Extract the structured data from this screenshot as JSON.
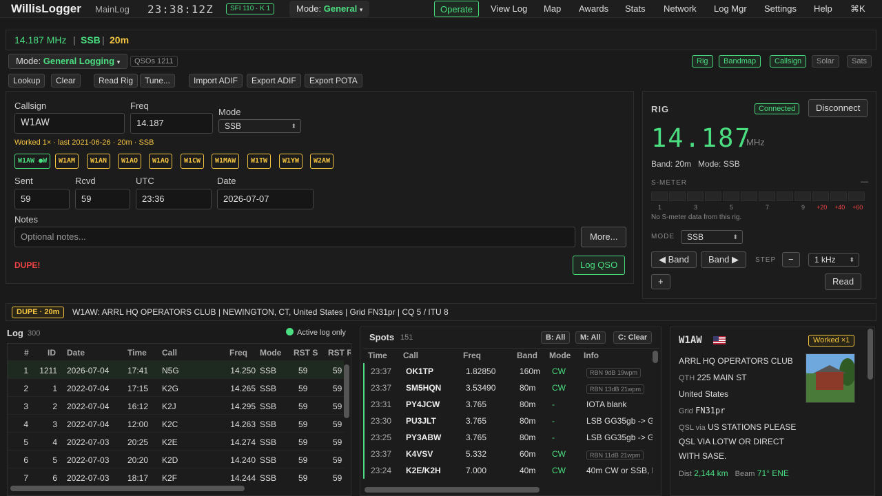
{
  "topbar": {
    "app_title": "WillisLogger",
    "log_name": "MainLog",
    "clock": "23:38:12Z",
    "sfi_badge": "SFI 110 · K 1",
    "mode_label": "Mode:",
    "mode_value": "General",
    "nav": [
      "Operate",
      "View Log",
      "Map",
      "Awards",
      "Stats",
      "Network",
      "Log Mgr",
      "Settings",
      "Help",
      "⌘K"
    ]
  },
  "freqline": {
    "freq": "14.187 MHz",
    "mode": "SSB",
    "band": "20m",
    "sep": "|"
  },
  "mode_row": {
    "label": "Mode:",
    "value": "General Logging",
    "qso_count": "QSOs 1211",
    "toggles": [
      "Rig",
      "Bandmap",
      "Callsign",
      "Solar",
      "Sats"
    ]
  },
  "toolbar": [
    "Lookup",
    "Clear",
    "Read Rig",
    "Tune...",
    "Import ADIF",
    "Export ADIF",
    "Export POTA"
  ],
  "entry": {
    "callsign_label": "Callsign",
    "callsign": "W1AW",
    "freq_label": "Freq",
    "freq": "14.187",
    "mode_label": "Mode",
    "mode": "SSB",
    "worked_info": "Worked 1× · last 2021-06-26 · 20m · SSB",
    "chips": [
      "W1AW ●W",
      "W1AM",
      "W1AN",
      "W1AO",
      "W1AQ",
      "W1CW",
      "W1MAW",
      "W1TW",
      "W1YW",
      "W2AW"
    ],
    "sent_label": "Sent",
    "sent": "59",
    "rcvd_label": "Rcvd",
    "rcvd": "59",
    "utc_label": "UTC",
    "utc": "23:36",
    "date_label": "Date",
    "date": "2026-07-07",
    "notes_label": "Notes",
    "notes_placeholder": "Optional notes...",
    "more_button": "More...",
    "dupe_label": "DUPE!",
    "log_button": "Log QSO"
  },
  "rig": {
    "title": "RIG",
    "status": "Connected",
    "disconnect": "Disconnect",
    "freq": "14.187",
    "unit": "MHz",
    "band_mode": "Band: 20m   Mode: SSB",
    "smeter_title": "S-METER",
    "smeter_dash": "—",
    "ticks": [
      "1",
      "3",
      "5",
      "7",
      "9",
      "+20",
      "+40",
      "+60"
    ],
    "smeter_note": "No S-meter data from this rig.",
    "mode_label": "MODE",
    "mode": "SSB",
    "band_down": "◀ Band",
    "band_up": "Band ▶",
    "step_label": "STEP",
    "minus": "−",
    "step": "1 kHz",
    "plus": "+",
    "read": "Read"
  },
  "dupeline": {
    "badge": "DUPE · 20m",
    "text": "W1AW: ARRL HQ OPERATORS CLUB | NEWINGTON, CT, United States | Grid FN31pr | CQ 5 / ITU 8"
  },
  "log": {
    "title": "Log",
    "count": "300",
    "active_only": "Active log only",
    "columns": [
      "#",
      "ID",
      "Date",
      "Time",
      "Call",
      "Freq",
      "Mode",
      "RST S",
      "RST R"
    ],
    "rows": [
      [
        "1",
        "1211",
        "2026-07-04",
        "17:41",
        "N5G",
        "14.250",
        "SSB",
        "59",
        "59"
      ],
      [
        "2",
        "1",
        "2022-07-04",
        "17:15",
        "K2G",
        "14.265",
        "SSB",
        "59",
        "59"
      ],
      [
        "3",
        "2",
        "2022-07-04",
        "16:12",
        "K2J",
        "14.295",
        "SSB",
        "59",
        "59"
      ],
      [
        "4",
        "3",
        "2022-07-04",
        "12:00",
        "K2C",
        "14.263",
        "SSB",
        "59",
        "59"
      ],
      [
        "5",
        "4",
        "2022-07-03",
        "20:25",
        "K2E",
        "14.274",
        "SSB",
        "59",
        "59"
      ],
      [
        "6",
        "5",
        "2022-07-03",
        "20:20",
        "K2D",
        "14.240",
        "SSB",
        "59",
        "59"
      ],
      [
        "7",
        "6",
        "2022-07-03",
        "18:17",
        "K2F",
        "14.244",
        "SSB",
        "59",
        "59"
      ]
    ]
  },
  "spots": {
    "title": "Spots",
    "count": "151",
    "filters": [
      "B: All",
      "M: All",
      "C: Clear"
    ],
    "columns": [
      "Time",
      "Call",
      "Freq",
      "Band",
      "Mode",
      "Info"
    ],
    "rows": [
      [
        "23:37",
        "OK1TP",
        "1.82850",
        "160m",
        "CW",
        "RBN 9dB 19wpm"
      ],
      [
        "23:37",
        "SM5HQN",
        "3.53490",
        "80m",
        "CW",
        "RBN 13dB 21wpm"
      ],
      [
        "23:31",
        "PY4JCW",
        "3.765",
        "80m",
        "-",
        "IOTA blank"
      ],
      [
        "23:30",
        "PU3JLT",
        "3.765",
        "80m",
        "-",
        "LSB GG35gb -> G"
      ],
      [
        "23:25",
        "PY3ABW",
        "3.765",
        "80m",
        "-",
        "LSB GG35gb -> G"
      ],
      [
        "23:37",
        "K4VSV",
        "5.332",
        "60m",
        "CW",
        "RBN 11dB 21wpm"
      ],
      [
        "23:24",
        "K2E/K2H",
        "7.000",
        "40m",
        "CW",
        "40m CW or SSB, l"
      ]
    ]
  },
  "callcard": {
    "call": "W1AW",
    "worked": "Worked ×1",
    "name": "ARRL HQ OPERATORS CLUB",
    "qth_label": "QTH",
    "qth": "225 MAIN ST",
    "country": "United States",
    "grid_label": "Grid",
    "grid": "FN31pr",
    "qsl_label": "QSL via",
    "qsl_1": "US STATIONS PLEASE",
    "qsl_2": "QSL VIA LOTW OR DIRECT",
    "qsl_3": "WITH SASE.",
    "dist_label": "Dist",
    "dist": "2,144 km",
    "beam_label": "Beam",
    "beam": "71° ENE"
  }
}
